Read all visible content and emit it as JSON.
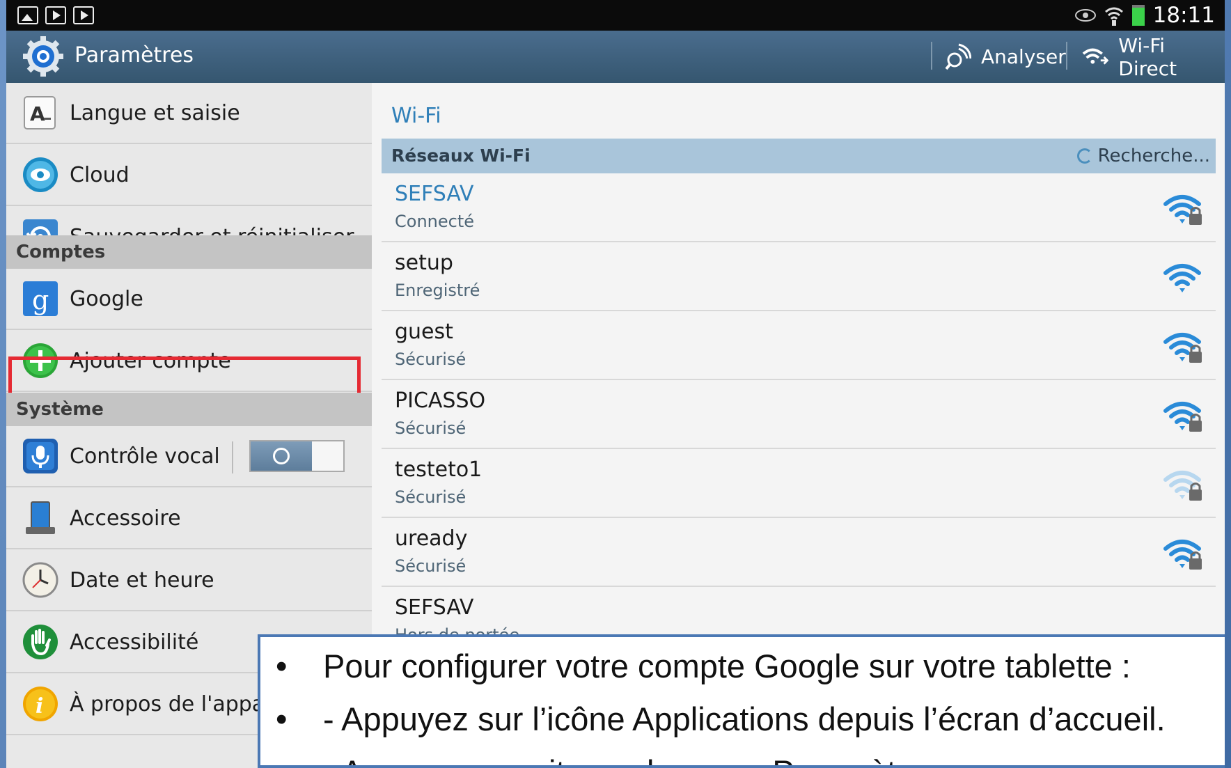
{
  "status_bar": {
    "time": "18:11",
    "left_icons": [
      "image-icon",
      "video-icon",
      "play-icon"
    ],
    "right_icons": [
      "smart-stay-eye-icon",
      "wifi-signal-icon",
      "battery-icon"
    ]
  },
  "action_bar": {
    "title": "Paramètres",
    "actions": [
      {
        "label": "Analyser",
        "icon": "scan-icon"
      },
      {
        "label": "Wi-Fi Direct",
        "icon": "wifi-direct-icon"
      }
    ]
  },
  "left_panel": {
    "items_top": [
      {
        "label": "Langue et saisie",
        "icon": "language-icon"
      },
      {
        "label": "Cloud",
        "icon": "cloud-icon"
      },
      {
        "label": "Sauvegarder et réinitialiser",
        "icon": "backup-reset-icon"
      }
    ],
    "section_accounts": "Comptes",
    "accounts": [
      {
        "label": "Google",
        "icon": "google-icon"
      },
      {
        "label": "Ajouter compte",
        "icon": "add-account-icon"
      }
    ],
    "section_system": "Système",
    "system": [
      {
        "label": "Contrôle vocal",
        "icon": "voice-control-icon",
        "toggle": "off"
      },
      {
        "label": "Accessoire",
        "icon": "accessory-icon"
      },
      {
        "label": "Date et heure",
        "icon": "clock-icon"
      },
      {
        "label": "Accessibilité",
        "icon": "accessibility-icon"
      },
      {
        "label": "À propos de l'appa",
        "icon": "info-icon"
      }
    ]
  },
  "right_panel": {
    "title": "Wi-Fi",
    "list_header": "Réseaux Wi-Fi",
    "searching_label": "Recherche...",
    "networks": [
      {
        "ssid": "SEFSAV",
        "status": "Connecté",
        "secured": true,
        "strength": "strong",
        "active": true
      },
      {
        "ssid": "setup",
        "status": "Enregistré",
        "secured": false,
        "strength": "strong"
      },
      {
        "ssid": "guest",
        "status": "Sécurisé",
        "secured": true,
        "strength": "strong"
      },
      {
        "ssid": "PICASSO",
        "status": "Sécurisé",
        "secured": true,
        "strength": "strong"
      },
      {
        "ssid": "testeto1",
        "status": "Sécurisé",
        "secured": true,
        "strength": "weak"
      },
      {
        "ssid": "uready",
        "status": "Sécurisé",
        "secured": true,
        "strength": "strong"
      },
      {
        "ssid": "SEFSAV",
        "status": "Hors de portée",
        "secured": false,
        "strength": "none"
      }
    ]
  },
  "overlay": {
    "lines": [
      "Pour configurer votre compte Google sur votre tablette :",
      "- Appuyez sur l’icône Applications depuis l’écran d’accueil.",
      "- Appuyez ensuite sur le menu Paramètres"
    ]
  },
  "colors": {
    "accent_blue": "#2f7fb8",
    "action_bar": "#3d5f7b",
    "highlight_red": "#e52a33"
  }
}
